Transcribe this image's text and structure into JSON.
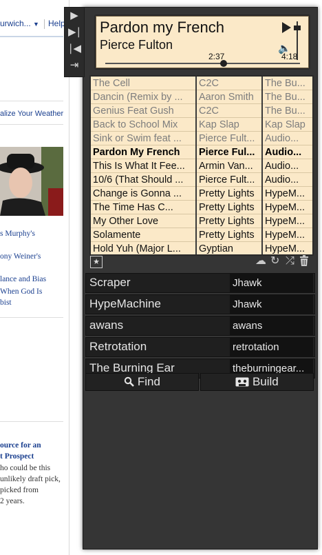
{
  "background_page": {
    "top_dropdown": "urwich...",
    "top_link": "Help",
    "weather_link": "alize Your Weather",
    "headlines": [
      "s Murphy's",
      "ony Weiner's",
      "lance and Bias",
      "When God Is",
      "bist"
    ],
    "article_title": [
      "ource for an",
      "t Prospect"
    ],
    "article_body": [
      "ho could be this",
      "unlikely draft pick,",
      "picked from",
      "2 years."
    ]
  },
  "controls": {
    "icons": [
      "play-icon",
      "next-track-icon",
      "previous-track-icon",
      "expand-panel-icon"
    ]
  },
  "now_playing": {
    "title": "Pardon my French",
    "artist": "Pierce Fulton",
    "elapsed": "2:37",
    "duration": "4:18",
    "progress": 0.608,
    "volume": 0.9
  },
  "playlist": {
    "current_index": 5,
    "played_count": 5,
    "rows": [
      [
        "The Cell",
        "C2C",
        "The Bu..."
      ],
      [
        "Dancin (Remix by ...",
        "Aaron Smith",
        "The Bu..."
      ],
      [
        "Genius Feat Gush",
        "C2C",
        "The Bu..."
      ],
      [
        "Back to School Mix",
        "Kap Slap",
        "Kap Slap"
      ],
      [
        "Sink or Swim feat ...",
        "Pierce Fult...",
        "Audio..."
      ],
      [
        "Pardon My French",
        "Pierce Ful...",
        "Audio..."
      ],
      [
        "This Is What It Fee...",
        "Armin Van...",
        "Audio..."
      ],
      [
        "10/6 (That Should ...",
        "Pierce Fult...",
        "Audio..."
      ],
      [
        "Change is Gonna ...",
        "Pretty Lights",
        "HypeM..."
      ],
      [
        "The Time Has C...",
        "Pretty Lights",
        "HypeM..."
      ],
      [
        "My Other Love",
        "Pretty Lights",
        "HypeM..."
      ],
      [
        "Solamente",
        "Pretty Lights",
        "HypeM..."
      ],
      [
        "Hold Yuh (Major L...",
        "Gyptian",
        "HypeM..."
      ]
    ]
  },
  "toolbar": {
    "star_icon": "star-icon",
    "icons": [
      "cloud-icon",
      "refresh-icon",
      "shuffle-icon",
      "trash-icon"
    ]
  },
  "sources": [
    {
      "name": "Scraper",
      "value": "Jhawk"
    },
    {
      "name": "HypeMachine",
      "value": "Jhawk"
    },
    {
      "name": "awans",
      "value": "awans"
    },
    {
      "name": "Retrotation",
      "value": "retrotation"
    },
    {
      "name": "The Burning Ear",
      "value": "theburningear..."
    }
  ],
  "actions": {
    "find_label": "Find",
    "find_icon": "magnifier-icon",
    "build_label": "Build",
    "build_icon": "cassette-icon"
  },
  "colors": {
    "panel_bg": "#353535",
    "list_bg": "#fbe9c8",
    "played_text": "#7d7d7d",
    "link_blue": "#1a3f8f"
  }
}
